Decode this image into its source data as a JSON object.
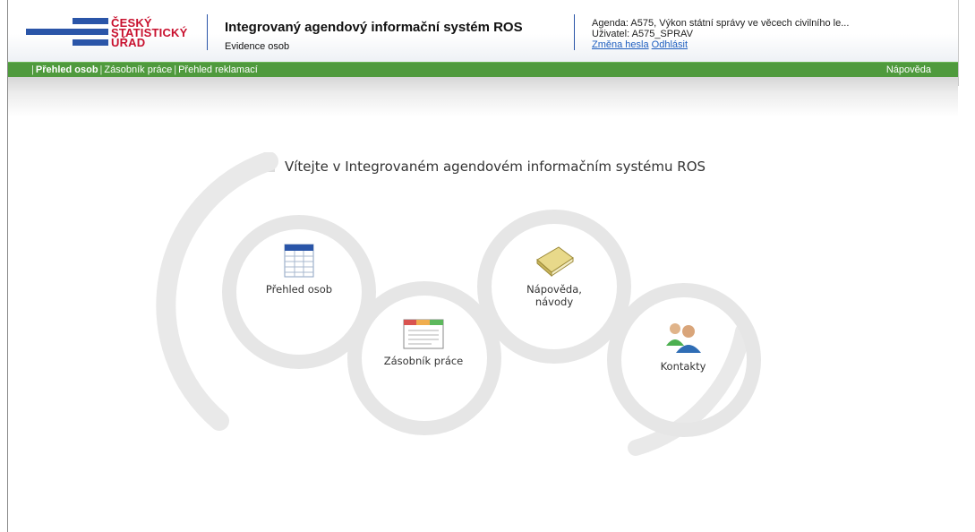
{
  "header": {
    "logo_lines": [
      "ČESKÝ",
      "STATISTICKÝ",
      "ÚŘAD"
    ],
    "system_title": "Integrovaný agendový informační systém ROS",
    "system_subtitle": "Evidence osob",
    "agenda_line": "Agenda: A575, Výkon státní správy ve věcech civilního le...",
    "user_line": "Uživatel: A575_SPRAV",
    "change_password": "Změna hesla",
    "logout": "Odhlásit"
  },
  "nav": {
    "items": [
      "Přehled osob",
      "Zásobník práce",
      "Přehled reklamací"
    ],
    "active_index": 0,
    "help": "Nápověda"
  },
  "main": {
    "welcome": "Vítejte v Integrovaném agendovém informačním systému ROS",
    "tiles": [
      {
        "label": "Přehled osob",
        "icon": "table-icon"
      },
      {
        "label": "Zásobník práce",
        "icon": "window-list-icon"
      },
      {
        "label": "Nápověda, návody",
        "icon": "book-icon"
      },
      {
        "label": "Kontakty",
        "icon": "people-icon"
      }
    ]
  },
  "colors": {
    "brand_blue": "#2a55a8",
    "brand_red": "#c8102e",
    "nav_green": "#4f9a3d",
    "link_blue": "#1f5fbf",
    "circle_gray": "#e6e6e6"
  }
}
